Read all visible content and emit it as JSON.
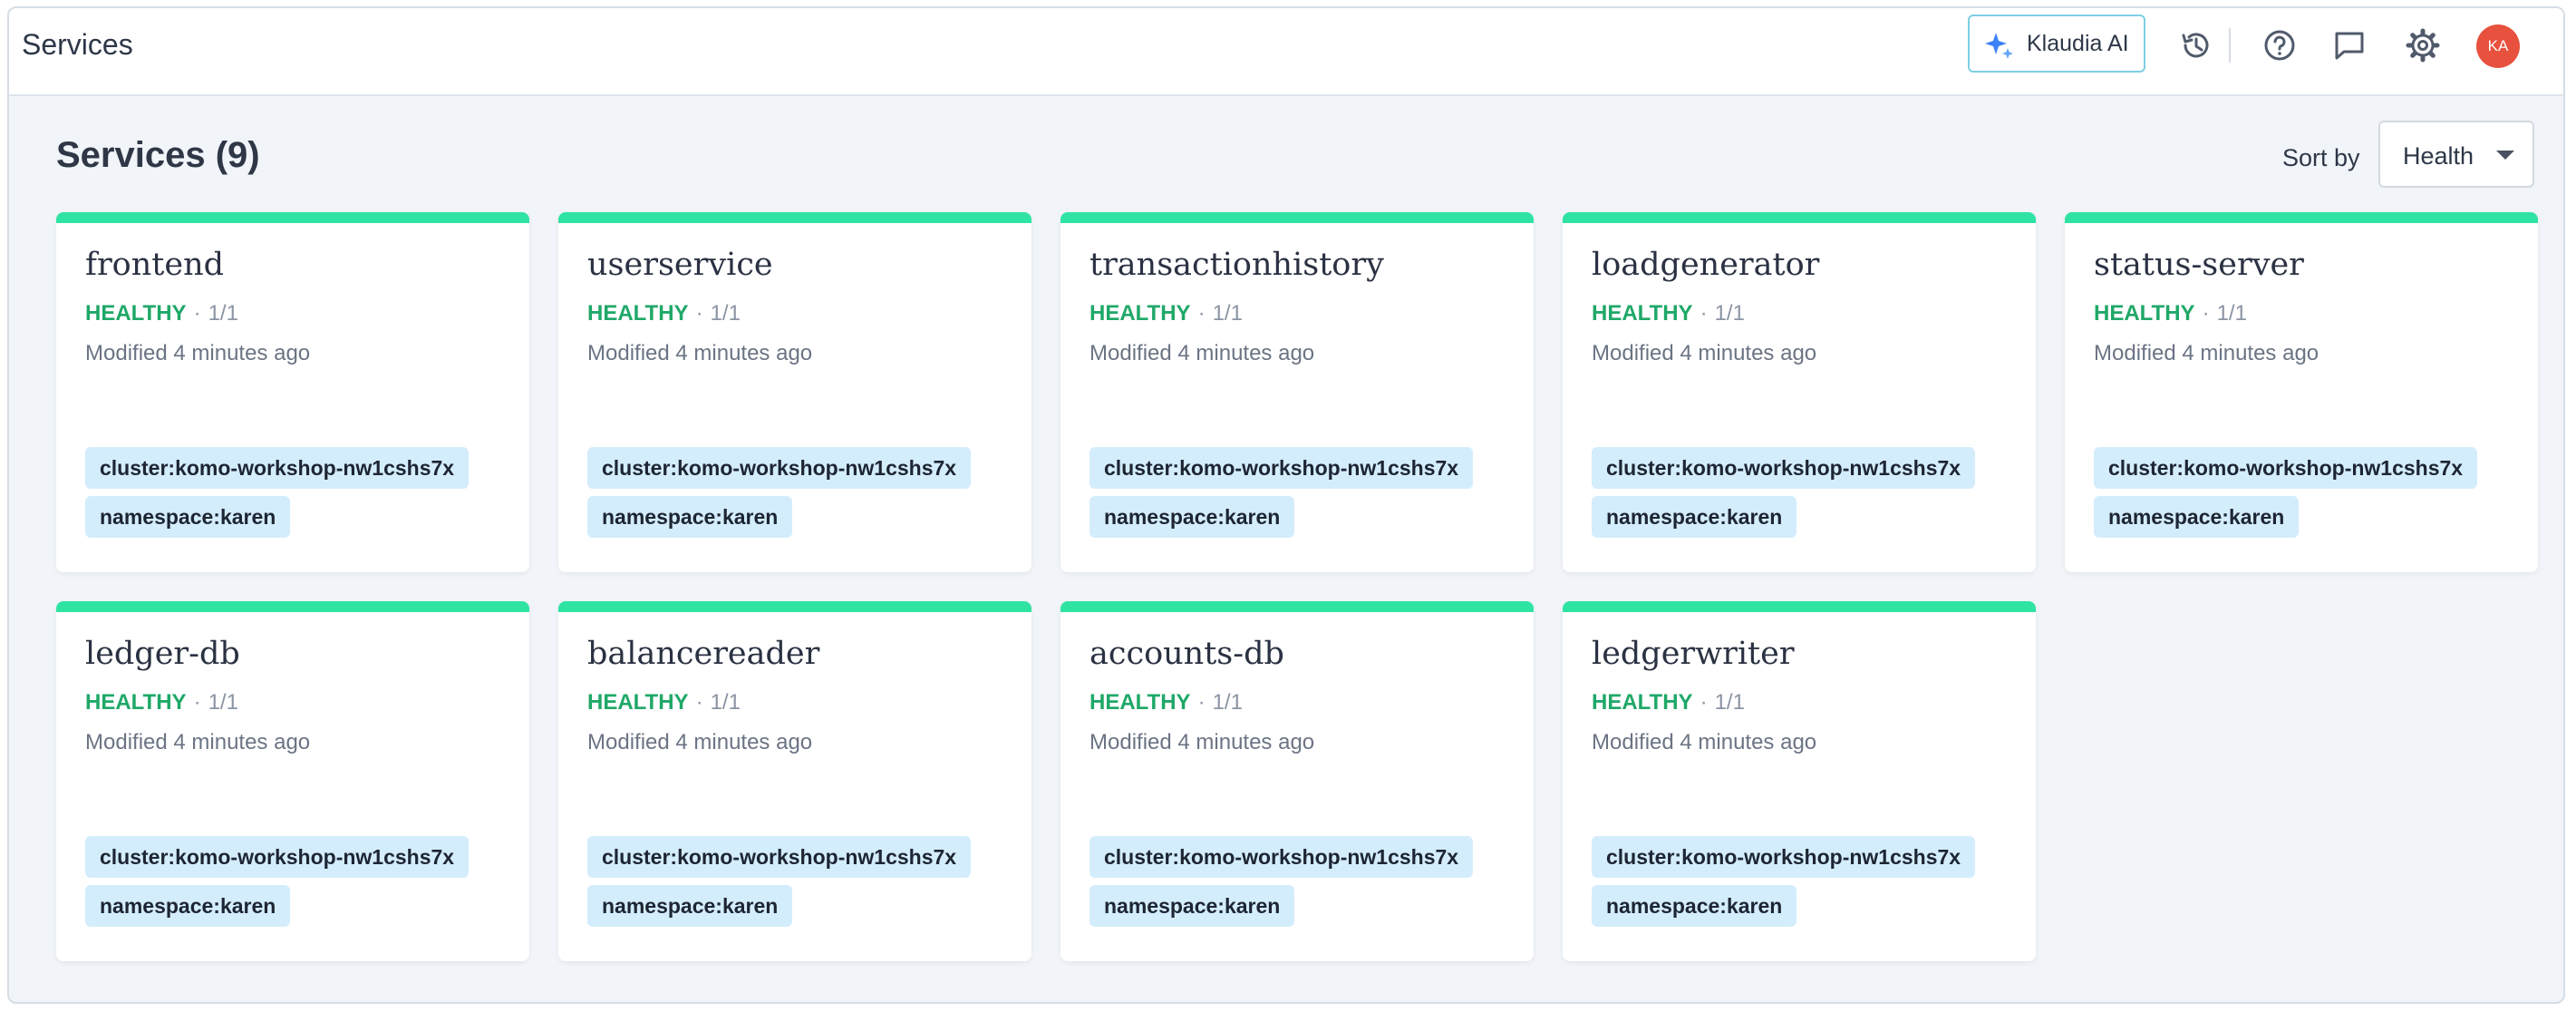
{
  "topbar": {
    "title": "Services",
    "ai_button_label": "Klaudia AI",
    "avatar_initials": "KA",
    "icons": [
      "sparkle-icon",
      "history-icon",
      "help-icon",
      "chat-icon",
      "gear-icon"
    ],
    "accent_color": "#2fe3a3"
  },
  "main": {
    "heading": "Services (9)",
    "sort_label": "Sort by",
    "sort_value": "Health"
  },
  "services": [
    {
      "name": "frontend",
      "status": "HEALTHY",
      "count": "1/1",
      "modified": "Modified 4 minutes ago",
      "cluster_tag": "cluster:komo-workshop-nw1cshs7x",
      "namespace_tag": "namespace:karen"
    },
    {
      "name": "userservice",
      "status": "HEALTHY",
      "count": "1/1",
      "modified": "Modified 4 minutes ago",
      "cluster_tag": "cluster:komo-workshop-nw1cshs7x",
      "namespace_tag": "namespace:karen"
    },
    {
      "name": "transactionhistory",
      "status": "HEALTHY",
      "count": "1/1",
      "modified": "Modified 4 minutes ago",
      "cluster_tag": "cluster:komo-workshop-nw1cshs7x",
      "namespace_tag": "namespace:karen"
    },
    {
      "name": "loadgenerator",
      "status": "HEALTHY",
      "count": "1/1",
      "modified": "Modified 4 minutes ago",
      "cluster_tag": "cluster:komo-workshop-nw1cshs7x",
      "namespace_tag": "namespace:karen"
    },
    {
      "name": "status-server",
      "status": "HEALTHY",
      "count": "1/1",
      "modified": "Modified 4 minutes ago",
      "cluster_tag": "cluster:komo-workshop-nw1cshs7x",
      "namespace_tag": "namespace:karen"
    },
    {
      "name": "ledger-db",
      "status": "HEALTHY",
      "count": "1/1",
      "modified": "Modified 4 minutes ago",
      "cluster_tag": "cluster:komo-workshop-nw1cshs7x",
      "namespace_tag": "namespace:karen"
    },
    {
      "name": "balancereader",
      "status": "HEALTHY",
      "count": "1/1",
      "modified": "Modified 4 minutes ago",
      "cluster_tag": "cluster:komo-workshop-nw1cshs7x",
      "namespace_tag": "namespace:karen"
    },
    {
      "name": "accounts-db",
      "status": "HEALTHY",
      "count": "1/1",
      "modified": "Modified 4 minutes ago",
      "cluster_tag": "cluster:komo-workshop-nw1cshs7x",
      "namespace_tag": "namespace:karen"
    },
    {
      "name": "ledgerwriter",
      "status": "HEALTHY",
      "count": "1/1",
      "modified": "Modified 4 minutes ago",
      "cluster_tag": "cluster:komo-workshop-nw1cshs7x",
      "namespace_tag": "namespace:karen"
    }
  ]
}
